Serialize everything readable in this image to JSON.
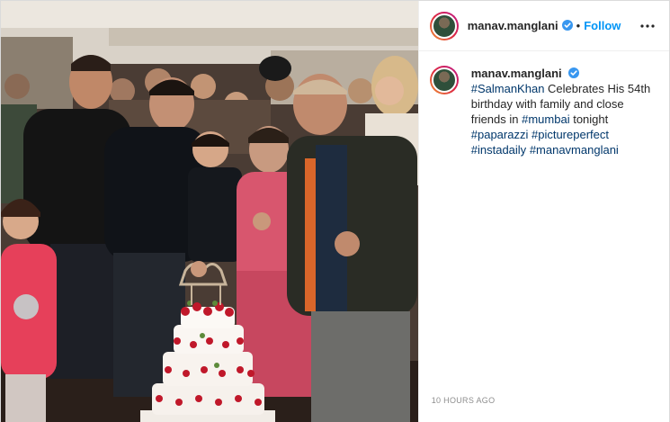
{
  "post": {
    "username": "manav.manglani",
    "follow_label": "Follow",
    "separator": "•",
    "timestamp": "10 HOURS AGO",
    "caption": {
      "mention": "#SalmanKhan",
      "text_1": "Celebrates His 54th birthday with family and close friends in",
      "hashtag_1": "#mumbai",
      "text_2": "tonight",
      "hashtag_2": "#paparazzi",
      "hashtag_3": "#pictureperfect",
      "hashtag_4": "#instadaily",
      "hashtag_5": "#manavmanglani"
    }
  },
  "icons": {
    "verified": "verified-badge-icon",
    "more": "more-options-icon"
  },
  "colors": {
    "link_blue": "#0095f6",
    "hashtag": "#00376b",
    "verified": "#3897f0",
    "muted": "#8e8e8e"
  }
}
